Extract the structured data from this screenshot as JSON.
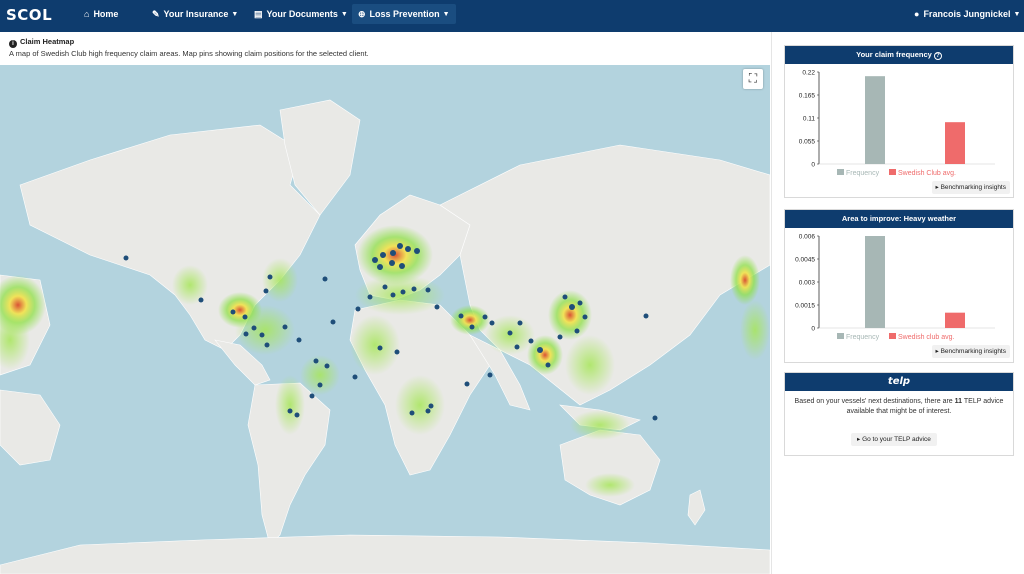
{
  "navbar": {
    "brand": "SCOL",
    "items": [
      {
        "label": "Home",
        "icon": "home-icon"
      },
      {
        "label": "Your Insurance",
        "icon": "document-edit-icon"
      },
      {
        "label": "Your Documents",
        "icon": "file-icon"
      },
      {
        "label": "Loss Prevention",
        "icon": "globe-icon"
      }
    ],
    "user": "Francois Jungnickel",
    "user_icon": "user-icon"
  },
  "heatmap": {
    "title": "Claim Heatmap",
    "description": "A map of Swedish Club high frequency claim areas. Map pins showing claim positions for the selected client.",
    "colors": {
      "water": "#b3d3de",
      "land": "#e8e8e8",
      "pin": "#1f4e79"
    }
  },
  "panels": {
    "frequency": {
      "title": "Your claim frequency",
      "button": "Benchmarking insights",
      "chart_data": {
        "type": "bar",
        "categories": [
          "Frequency",
          "Swedish Club avg."
        ],
        "values": [
          0.21,
          0.1
        ],
        "colors": [
          "#a7b7b5",
          "#ef6b6b"
        ],
        "yticks": [
          "0.22",
          "0.165",
          "0.11",
          "0.055",
          "0"
        ],
        "ylim": [
          0,
          0.22
        ]
      }
    },
    "improve": {
      "title": "Area to improve: Heavy weather",
      "button": "Benchmarking insights",
      "chart_data": {
        "type": "bar",
        "categories": [
          "Frequency",
          "Swedish club avg."
        ],
        "values": [
          0.006,
          0.001
        ],
        "colors": [
          "#a7b7b5",
          "#ef6b6b"
        ],
        "yticks": [
          "0.006",
          "0.0045",
          "0.003",
          "0.0015",
          "0"
        ],
        "ylim": [
          0,
          0.006
        ]
      }
    },
    "telp": {
      "title": "telp",
      "text_before": "Based on your vessels' next destinations, there are ",
      "count": "11",
      "text_after": " TELP advice available that might be of interest.",
      "button": "Go to your TELP advice"
    }
  }
}
